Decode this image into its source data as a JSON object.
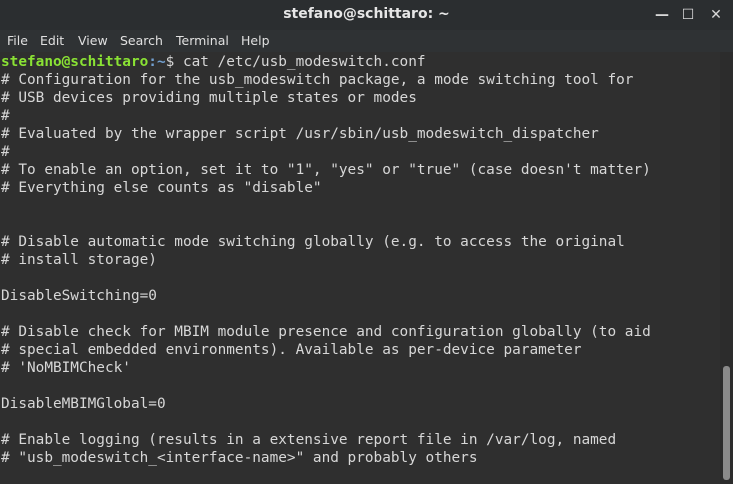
{
  "window": {
    "title": "stefano@schittaro: ~",
    "controls": {
      "minimize": "—",
      "maximize": "☐",
      "close": "✕"
    }
  },
  "menu": [
    "File",
    "Edit",
    "View",
    "Search",
    "Terminal",
    "Help"
  ],
  "prompt": {
    "user_host": "stefano@schittaro",
    "path": ":~",
    "symbol": "$ ",
    "command": "cat /etc/usb_modeswitch.conf"
  },
  "output_lines": [
    "# Configuration for the usb_modeswitch package, a mode switching tool for",
    "# USB devices providing multiple states or modes",
    "#",
    "# Evaluated by the wrapper script /usr/sbin/usb_modeswitch_dispatcher",
    "#",
    "# To enable an option, set it to \"1\", \"yes\" or \"true\" (case doesn't matter)",
    "# Everything else counts as \"disable\"",
    "",
    "",
    "# Disable automatic mode switching globally (e.g. to access the original",
    "# install storage)",
    "",
    "DisableSwitching=0",
    "",
    "# Disable check for MBIM module presence and configuration globally (to aid",
    "# special embedded environments). Available as per-device parameter",
    "# 'NoMBIMCheck'",
    "",
    "DisableMBIMGlobal=0",
    "",
    "# Enable logging (results in a extensive report file in /var/log, named",
    "# \"usb_modeswitch_<interface-name>\" and probably others"
  ],
  "colors": {
    "background": "#2f2f2f",
    "text": "#d7d7d7",
    "prompt_user": "#8ae234",
    "prompt_path": "#729fcf"
  }
}
